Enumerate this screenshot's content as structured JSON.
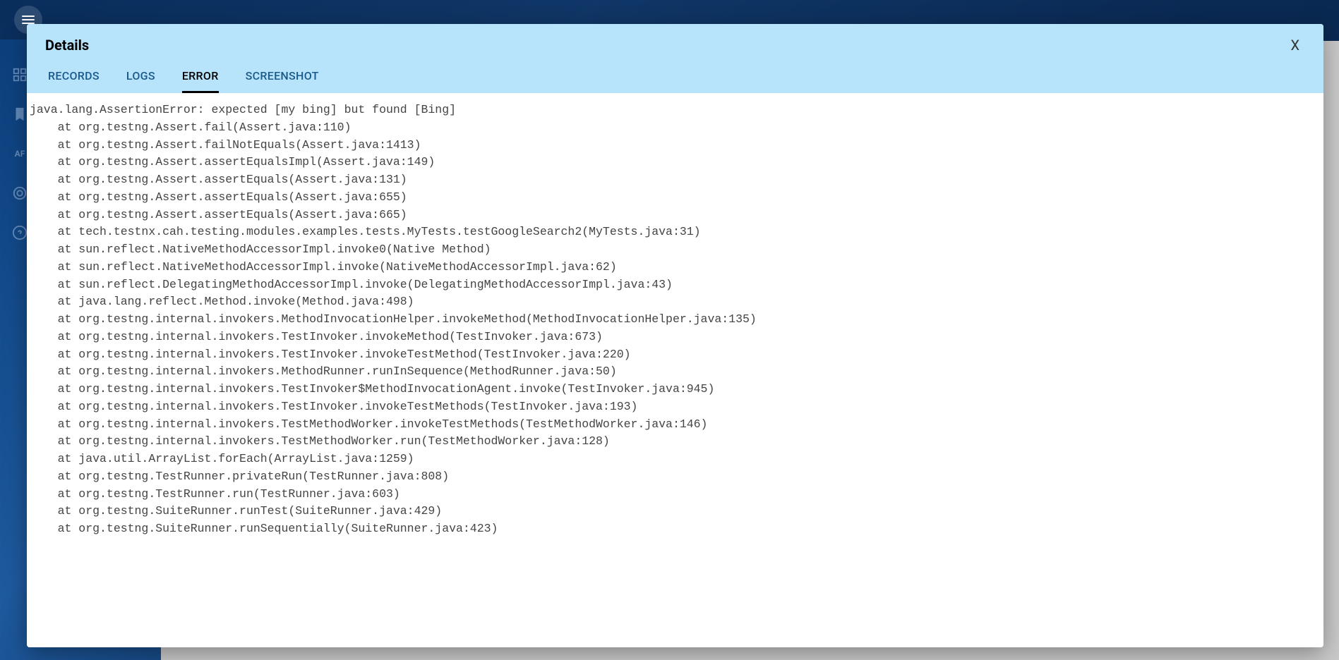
{
  "header": {},
  "modal": {
    "title": "Details",
    "close_label": "X",
    "tabs": [
      {
        "id": "records",
        "label": "RECORDS",
        "active": false
      },
      {
        "id": "logs",
        "label": "LOGS",
        "active": false
      },
      {
        "id": "error",
        "label": "ERROR",
        "active": true
      },
      {
        "id": "screenshot",
        "label": "SCREENSHOT",
        "active": false
      }
    ],
    "error": {
      "message": "java.lang.AssertionError: expected [my bing] but found [Bing]",
      "stack": [
        "at org.testng.Assert.fail(Assert.java:110)",
        "at org.testng.Assert.failNotEquals(Assert.java:1413)",
        "at org.testng.Assert.assertEqualsImpl(Assert.java:149)",
        "at org.testng.Assert.assertEquals(Assert.java:131)",
        "at org.testng.Assert.assertEquals(Assert.java:655)",
        "at org.testng.Assert.assertEquals(Assert.java:665)",
        "at tech.testnx.cah.testing.modules.examples.tests.MyTests.testGoogleSearch2(MyTests.java:31)",
        "at sun.reflect.NativeMethodAccessorImpl.invoke0(Native Method)",
        "at sun.reflect.NativeMethodAccessorImpl.invoke(NativeMethodAccessorImpl.java:62)",
        "at sun.reflect.DelegatingMethodAccessorImpl.invoke(DelegatingMethodAccessorImpl.java:43)",
        "at java.lang.reflect.Method.invoke(Method.java:498)",
        "at org.testng.internal.invokers.MethodInvocationHelper.invokeMethod(MethodInvocationHelper.java:135)",
        "at org.testng.internal.invokers.TestInvoker.invokeMethod(TestInvoker.java:673)",
        "at org.testng.internal.invokers.TestInvoker.invokeTestMethod(TestInvoker.java:220)",
        "at org.testng.internal.invokers.MethodRunner.runInSequence(MethodRunner.java:50)",
        "at org.testng.internal.invokers.TestInvoker$MethodInvocationAgent.invoke(TestInvoker.java:945)",
        "at org.testng.internal.invokers.TestInvoker.invokeTestMethods(TestInvoker.java:193)",
        "at org.testng.internal.invokers.TestMethodWorker.invokeTestMethods(TestMethodWorker.java:146)",
        "at org.testng.internal.invokers.TestMethodWorker.run(TestMethodWorker.java:128)",
        "at java.util.ArrayList.forEach(ArrayList.java:1259)",
        "at org.testng.TestRunner.privateRun(TestRunner.java:808)",
        "at org.testng.TestRunner.run(TestRunner.java:603)",
        "at org.testng.SuiteRunner.runTest(SuiteRunner.java:429)",
        "at org.testng.SuiteRunner.runSequentially(SuiteRunner.java:423)"
      ]
    }
  }
}
